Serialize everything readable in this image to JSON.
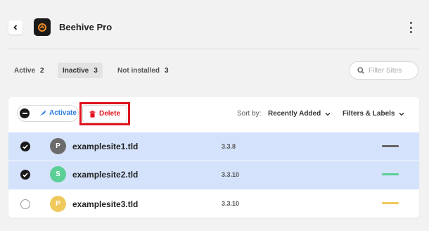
{
  "header": {
    "back_icon": "chevron-left-icon",
    "logo_icon": "beehive-logo-icon",
    "title": "Beehive Pro",
    "menu_icon": "kebab-menu-icon"
  },
  "tabs": [
    {
      "label": "Active",
      "count": "2"
    },
    {
      "label": "Inactive",
      "count": "3"
    },
    {
      "label": "Not installed",
      "count": "3"
    }
  ],
  "search": {
    "placeholder": "Filter Sites",
    "icon": "search-icon"
  },
  "toolbar": {
    "activate_label": "Activate",
    "activate_icon": "feather-icon",
    "delete_label": "Delete",
    "delete_icon": "trash-icon",
    "sort_label": "Sort by:",
    "sort_value": "Recently Added",
    "filters_label": "Filters & Labels"
  },
  "rows": [
    {
      "initial": "P",
      "name": "examplesite1.tld",
      "version": "3.3.8",
      "checked": true,
      "avatar_color": "#6b6b6b",
      "status_color": "#666666"
    },
    {
      "initial": "S",
      "name": "examplesite2.tld",
      "version": "3.3.10",
      "checked": true,
      "avatar_color": "#5ccf96",
      "status_color": "#5ccf96"
    },
    {
      "initial": "P",
      "name": "examplesite3.tld",
      "version": "3.3.10",
      "checked": false,
      "avatar_color": "#f0c95c",
      "status_color": "#f0c95c"
    }
  ],
  "colors": {
    "accent_blue": "#2a7ae2",
    "danger_red": "#e0141e",
    "selected_row": "#d4e2fb"
  }
}
